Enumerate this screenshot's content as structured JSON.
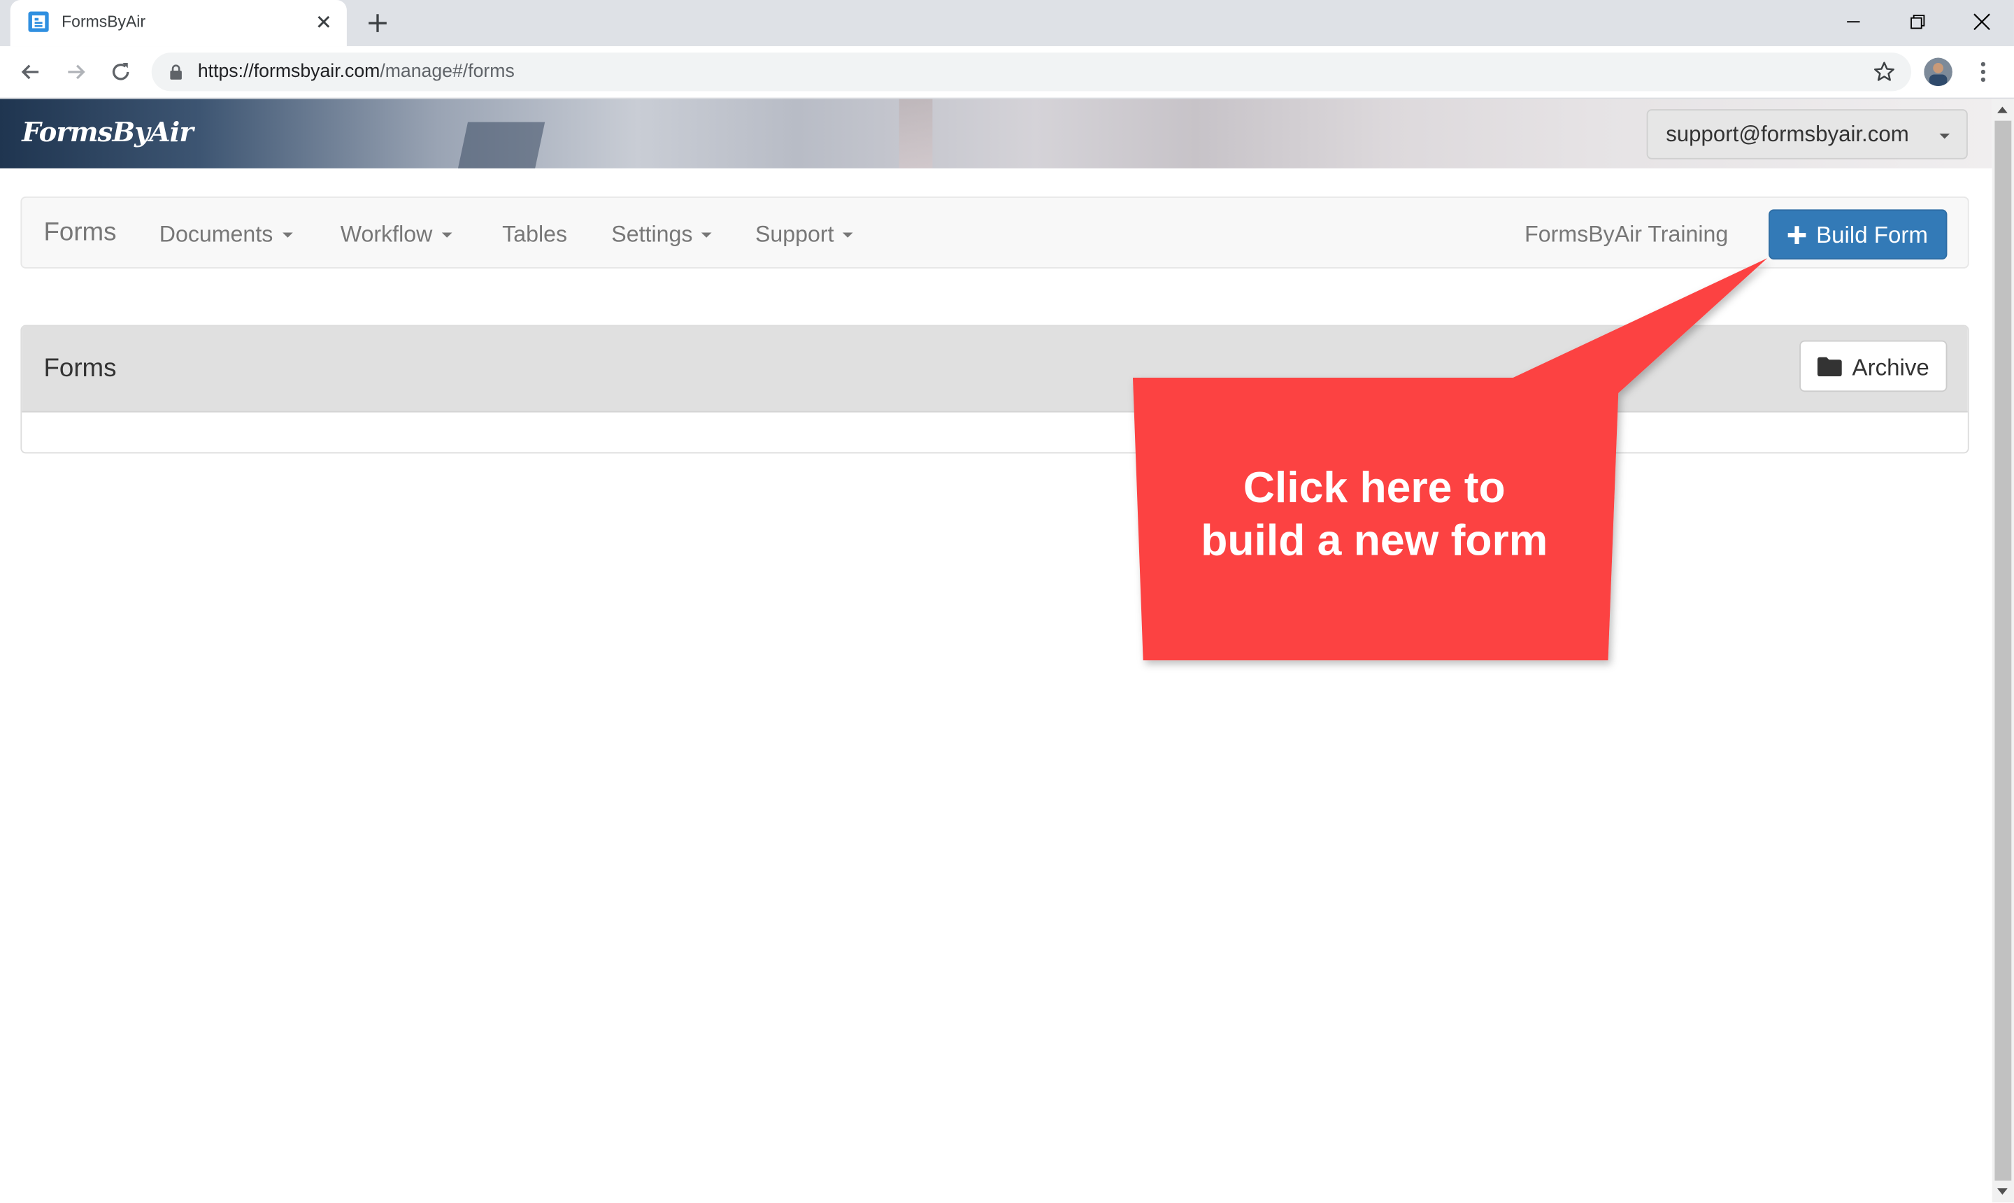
{
  "browser": {
    "tab_title": "FormsByAir",
    "url_host": "https://formsbyair.com",
    "url_path": "/manage#/forms"
  },
  "header": {
    "logo": "FormsByAir",
    "user_email": "support@formsbyair.com"
  },
  "navbar": {
    "brand": "Forms",
    "items": [
      {
        "label": "Documents"
      },
      {
        "label": "Workflow"
      },
      {
        "label": "Tables"
      },
      {
        "label": "Settings"
      },
      {
        "label": "Support"
      }
    ],
    "org_name": "FormsByAir Training",
    "build_label": "Build Form"
  },
  "panel": {
    "title": "Forms",
    "archive_label": "Archive"
  },
  "callout": {
    "line1": "Click here to",
    "line2": "build a new form"
  },
  "colors": {
    "primary": "#337ab7",
    "callout": "#fc4242"
  }
}
